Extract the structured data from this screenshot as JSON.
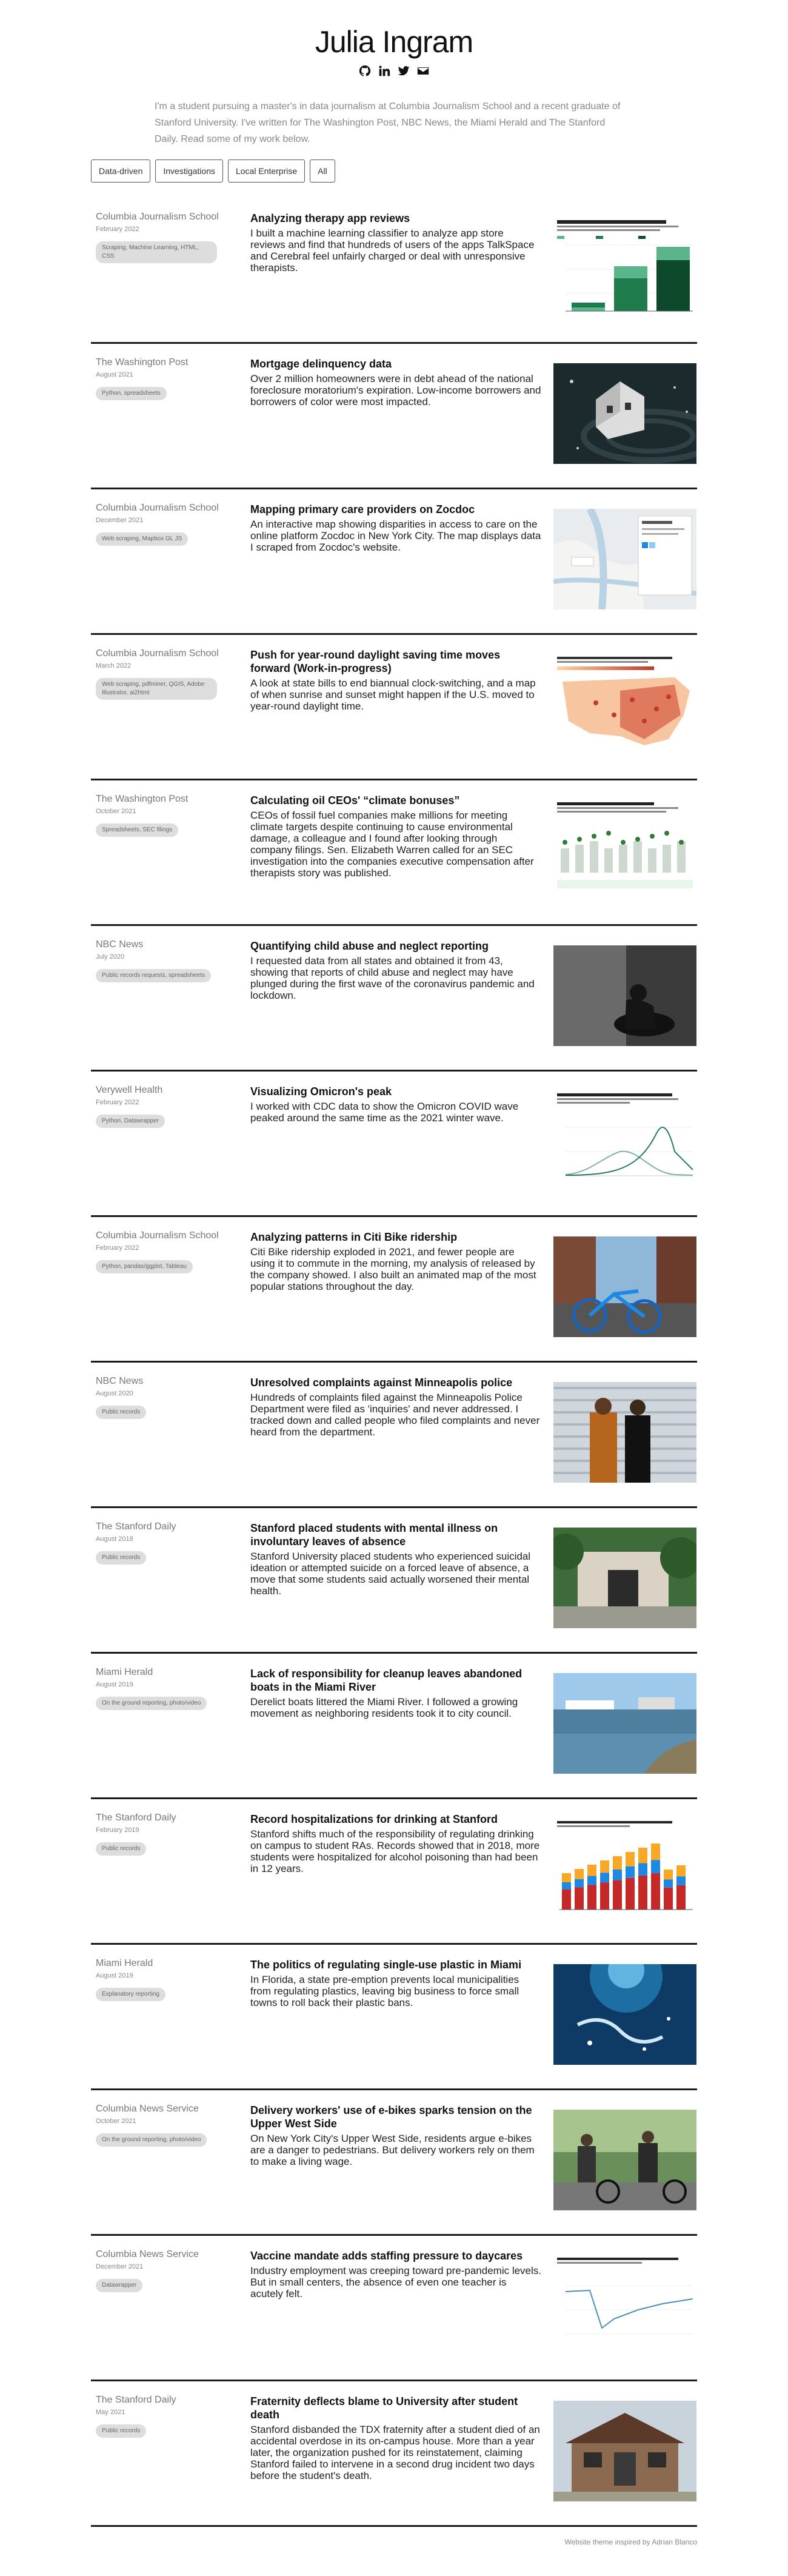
{
  "header": {
    "name": "Julia Ingram",
    "social_icons": [
      "github-icon",
      "linkedin-icon",
      "twitter-icon",
      "email-icon"
    ]
  },
  "intro": {
    "text": "I'm a student pursuing a master's in data journalism at Columbia Journalism School and a recent graduate of Stanford University. I've written for The Washington Post, NBC News, the Miami Herald and The Stanford Daily. Read some of my work below."
  },
  "filters": [
    "Data-driven",
    "Investigations",
    "Local Enterprise",
    "All"
  ],
  "projects": [
    {
      "outlet": "Columbia Journalism School",
      "date": "February 2022",
      "tags": "Scraping, Machine Learning, HTML, CSS",
      "title": "Analyzing therapy app reviews",
      "desc": "I built a machine learning classifier to analyze app store reviews and find that hundreds of users of the apps TalkSpace and Cerebral feel unfairly charged or deal with unresponsive therapists.",
      "thumb": "bar-chart-thumb"
    },
    {
      "outlet": "The Washington Post",
      "date": "August 2021",
      "tags": "Python, spreadsheets",
      "title": "Mortgage delinquency data",
      "desc": "Over 2 million homeowners were in debt ahead of the national foreclosure moratorium's expiration. Low-income borrowers and borrowers of color were most impacted.",
      "thumb": "house-illustration-thumb"
    },
    {
      "outlet": "Columbia Journalism School",
      "date": "December 2021",
      "tags": "Web scraping, Mapbox GL JS",
      "title": "Mapping primary care providers on Zocdoc",
      "desc": "An interactive map showing disparities in access to care on the online platform Zocdoc in New York City. The map displays data I scraped from Zocdoc's website.",
      "thumb": "map-thumb"
    },
    {
      "outlet": "Columbia Journalism School",
      "date": "March 2022",
      "tags": "Web scraping, pdfminer, QGIS, Adobe Illustrator, ai2html",
      "title": "Push for year-round daylight saving time moves forward (Work-in-progress)",
      "desc": "A look at state bills to end biannual clock-switching, and a map of when sunrise and sunset might happen if the U.S. moved to year-round daylight time.",
      "thumb": "us-map-thumb"
    },
    {
      "outlet": "The Washington Post",
      "date": "October 2021",
      "tags": "Spreadsheets, SEC filings",
      "title": "Calculating oil CEOs' “climate bonuses”",
      "desc": "CEOs of fossil fuel companies make millions for meeting climate targets despite continuing to cause environmental damage, a colleague and I found after looking through company filings. Sen. Elizabeth Warren called for an SEC investigation into the companies executive compensation after therapists story was published.",
      "thumb": "dot-chart-thumb"
    },
    {
      "outlet": "NBC News",
      "date": "July 2020",
      "tags": "Public records requests, spreadsheets",
      "title": "Quantifying child abuse and neglect reporting",
      "desc": "I requested data from all states and obtained it from 43, showing that reports of child abuse and neglect may have plunged during the first wave of the coronavirus pandemic and lockdown.",
      "thumb": "bw-photo-thumb"
    },
    {
      "outlet": "Verywell Health",
      "date": "February 2022",
      "tags": "Python, Datawrapper",
      "title": "Visualizing Omicron's peak",
      "desc": "I worked with CDC data to show the Omicron COVID wave peaked around the same time as the 2021 winter wave.",
      "thumb": "line-chart-thumb"
    },
    {
      "outlet": "Columbia Journalism School",
      "date": "February 2022",
      "tags": "Python, pandas/ggplot, Tableau",
      "title": "Analyzing patterns in Citi Bike ridership",
      "desc": "Citi Bike ridership exploded in 2021, and fewer people are using it to commute in the morning, my analysis of released by the company showed. I also built an animated map of the most popular stations throughout the day.",
      "thumb": "bikes-photo-thumb"
    },
    {
      "outlet": "NBC News",
      "date": "August 2020",
      "tags": "Public records",
      "title": "Unresolved complaints against Minneapolis police",
      "desc": "Hundreds of complaints filed against the Minneapolis Police Department were filed as 'inquiries' and never addressed. I tracked down and called people who filed complaints and never heard from the department.",
      "thumb": "people-photo-thumb"
    },
    {
      "outlet": "The Stanford Daily",
      "date": "August 2018",
      "tags": "Public records",
      "title": "Stanford placed students with mental illness on involuntary leaves of absence",
      "desc": "Stanford University placed students who experienced suicidal ideation or attempted suicide on a forced leave of absence, a move that some students said actually worsened their mental health.",
      "thumb": "building-photo-thumb"
    },
    {
      "outlet": "Miami Herald",
      "date": "August 2019",
      "tags": "On the ground reporting, photo/video",
      "title": "Lack of responsibility for cleanup leaves abandoned boats in the Miami River",
      "desc": "Derelict boats littered the Miami River. I followed a growing movement as neighboring residents took it to city council.",
      "thumb": "river-photo-thumb"
    },
    {
      "outlet": "The Stanford Daily",
      "date": "February 2019",
      "tags": "Public records",
      "title": "Record hospitalizations for drinking at Stanford",
      "desc": "Stanford shifts much of the responsibility of regulating drinking on campus to student RAs. Records showed that in 2018, more students were hospitalized for alcohol poisoning than had been in 12 years.",
      "thumb": "stacked-bar-thumb"
    },
    {
      "outlet": "Miami Herald",
      "date": "August 2019",
      "tags": "Explanatory reporting",
      "title": "The politics of regulating single-use plastic in Miami",
      "desc": "In Florida, a state pre-emption prevents local municipalities from regulating plastics, leaving big business to force small towns to roll back their plastic bans.",
      "thumb": "ocean-photo-thumb"
    },
    {
      "outlet": "Columbia News Service",
      "date": "October 2021",
      "tags": "On the ground reporting, photo/video",
      "title": "Delivery workers' use of e-bikes sparks tension on the Upper West Side",
      "desc": "On New York City's Upper West Side, residents argue e-bikes are a danger to pedestrians. But delivery workers rely on them to make a living wage.",
      "thumb": "ebikes-photo-thumb"
    },
    {
      "outlet": "Columbia News Service",
      "date": "December 2021",
      "tags": "Datawrapper",
      "title": "Vaccine mandate adds staffing pressure to daycares",
      "desc": "Industry employment was creeping toward pre-pandemic levels. But in small centers, the absence of even one teacher is acutely felt.",
      "thumb": "line-chart-2-thumb"
    },
    {
      "outlet": "The Stanford Daily",
      "date": "May 2021",
      "tags": "Public records",
      "title": "Fraternity deflects blame to University after student death",
      "desc": "Stanford disbanded the TDX fraternity after a student died of an accidental overdose in its on-campus house. More than a year later, the organization pushed for its reinstatement, claiming Stanford failed to intervene in a second drug incident two days before the student's death.",
      "thumb": "house-photo-thumb"
    }
  ],
  "footer": {
    "text": "Website theme inspired by Adrian Blanco"
  }
}
